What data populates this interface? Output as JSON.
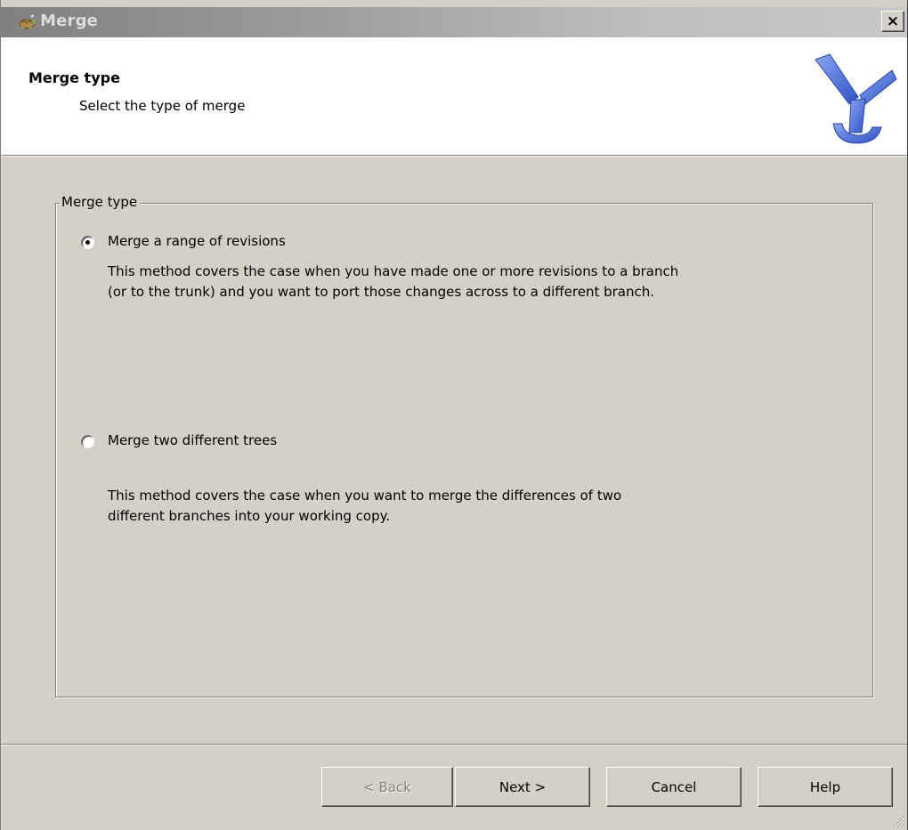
{
  "window": {
    "title": "Merge",
    "close_label": "×"
  },
  "header": {
    "title": "Merge type",
    "subtitle": "Select the type of merge"
  },
  "group": {
    "legend": "Merge type",
    "options": [
      {
        "label": "Merge a range of revisions",
        "checked": true,
        "description_lines": [
          "This method covers the case when you have made one or more revisions to a branch",
          "(or to the trunk) and you want to port those changes across to a different branch."
        ]
      },
      {
        "label": "Merge two different trees",
        "checked": false,
        "description_lines": [
          "This method covers the case when you want to merge the differences of two",
          "different branches into your working copy."
        ]
      }
    ]
  },
  "buttons": {
    "back": "< Back",
    "next": "Next >",
    "cancel": "Cancel",
    "help": "Help"
  },
  "icons": {
    "title": "tortoise-icon",
    "logo": "merge-logo-icon"
  },
  "colors": {
    "logo": "#4a6fd6",
    "dialog_bg": "#d4d0c8"
  }
}
